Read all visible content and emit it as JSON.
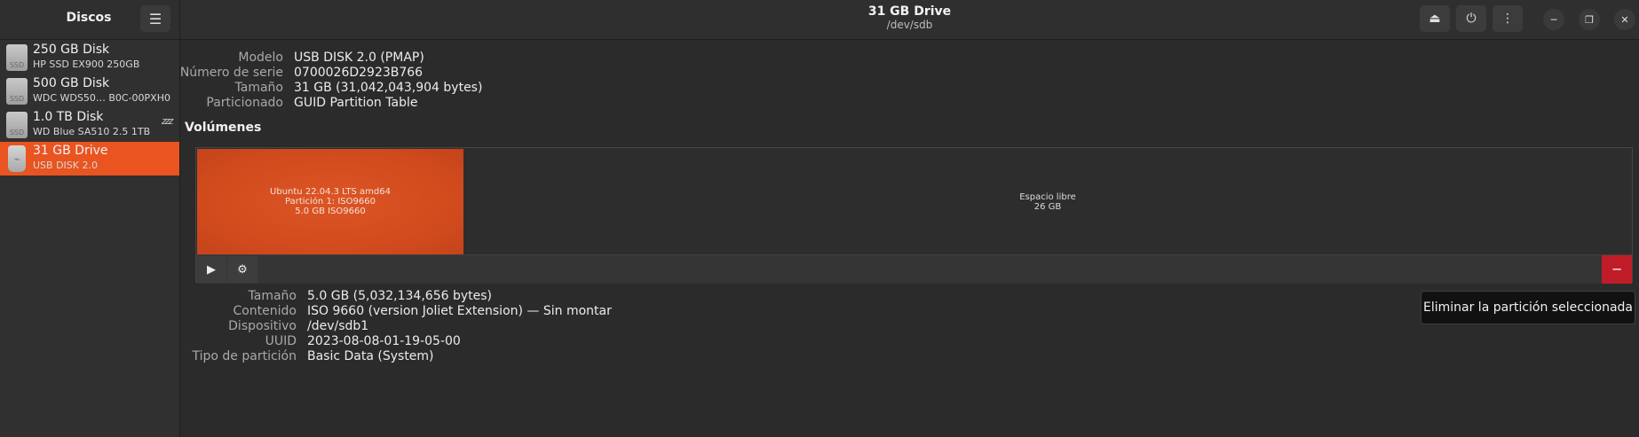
{
  "sidebar": {
    "title": "Discos",
    "menu_icon": "hamburger-icon",
    "disks": [
      {
        "name": "250 GB Disk",
        "model": "HP SSD EX900 250GB",
        "icon": "ssd-icon",
        "icon_text": "SSD",
        "selected": false
      },
      {
        "name": "500 GB Disk",
        "model": "WDC WDS50…  B0C-00PXH0",
        "icon": "ssd-icon",
        "icon_text": "SSD",
        "selected": false
      },
      {
        "name": "1.0 TB Disk",
        "model": "WD Blue SA510 2.5 1TB",
        "icon": "ssd-icon",
        "icon_text": "SSD",
        "selected": false,
        "status_icon": "sleep-icon",
        "status_text": "zzz"
      },
      {
        "name": "31 GB Drive",
        "model": "USB DISK 2.0",
        "icon": "usb-icon",
        "icon_text": "⌁",
        "selected": true
      }
    ]
  },
  "header": {
    "title": "31 GB Drive",
    "subtitle": "/dev/sdb",
    "buttons": [
      "eject-icon",
      "power-icon",
      "more-options-icon"
    ],
    "window_controls": [
      "minimize-icon",
      "restore-icon",
      "close-icon"
    ]
  },
  "drive_info": [
    {
      "label": "Modelo",
      "value": "USB DISK 2.0 (PMAP)"
    },
    {
      "label": "Número de serie",
      "value": "0700026D2923B766"
    },
    {
      "label": "Tamaño",
      "value": "31 GB (31,042,043,904 bytes)"
    },
    {
      "label": "Particionado",
      "value": "GUID Partition Table"
    }
  ],
  "volumes": {
    "heading": "Volúmenes",
    "partition": {
      "line1": "Ubuntu 22.04.3 LTS amd64",
      "line2": "Partición 1: ISO9660",
      "line3": "5.0 GB ISO9660",
      "color": "#dd5525"
    },
    "free_space": {
      "label": "Espacio libre",
      "size": "26 GB"
    },
    "toolbar": {
      "play_icon": "play-icon",
      "settings_icon": "gear-icon",
      "delete_icon": "minus-icon"
    }
  },
  "partition_info": [
    {
      "label": "Tamaño",
      "value": "5.0 GB (5,032,134,656 bytes)"
    },
    {
      "label": "Contenido",
      "value": "ISO 9660 (version Joliet Extension) — Sin montar"
    },
    {
      "label": "Dispositivo",
      "value": "/dev/sdb1"
    },
    {
      "label": "UUID",
      "value": "2023-08-08-01-19-05-00"
    },
    {
      "label": "Tipo de partición",
      "value": "Basic Data (System)"
    }
  ],
  "tooltip": "Eliminar la partición seleccionada",
  "colors": {
    "accent": "#e95420",
    "destructive": "#c01c28",
    "background": "#2b2b2b"
  }
}
